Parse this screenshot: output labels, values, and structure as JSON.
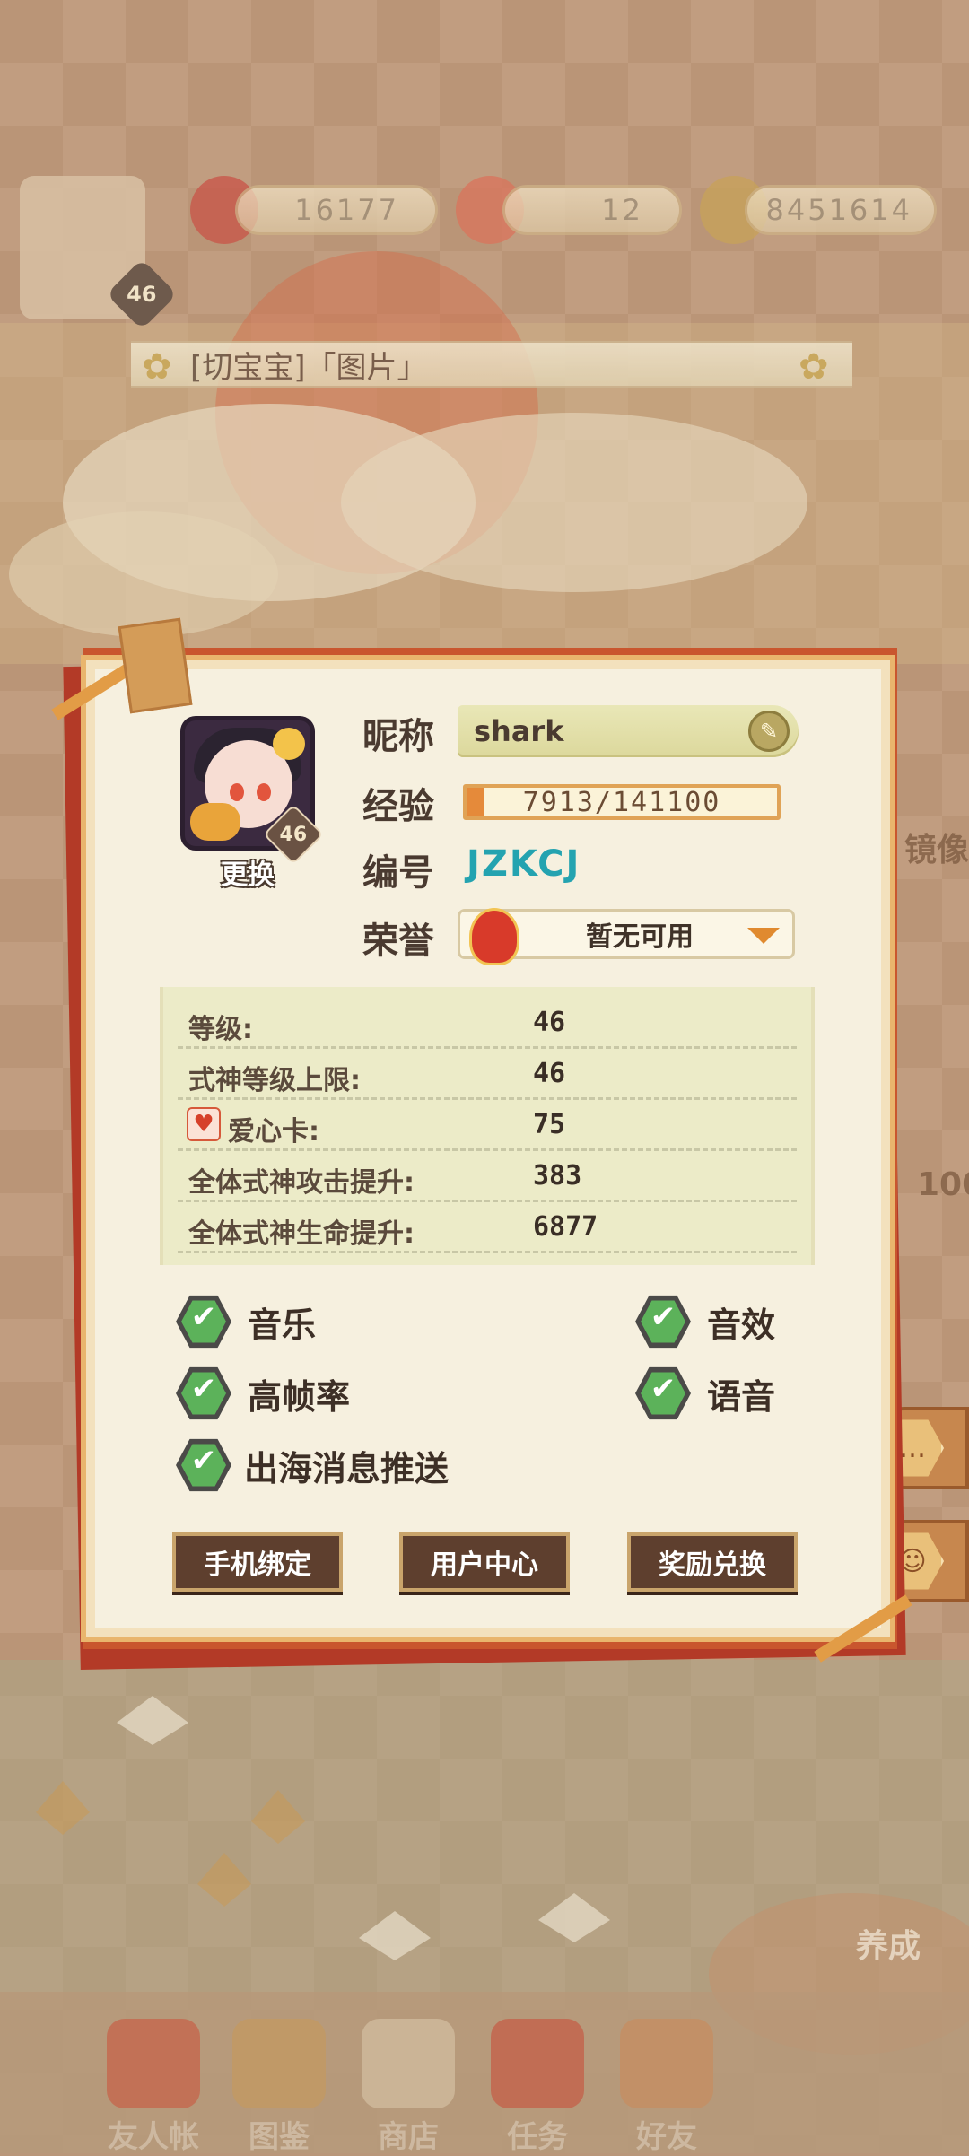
{
  "resources": {
    "jade": "16177",
    "stamina": "12",
    "coins": "8451614",
    "player_level": "46"
  },
  "notice": {
    "text": "[切宝宝]「图片」"
  },
  "background_labels": {
    "portrait_hint": "镜像",
    "training": "养成",
    "partial_number": "100"
  },
  "bottom_nav": [
    {
      "label": "友人帐"
    },
    {
      "label": "图鉴"
    },
    {
      "label": "商店"
    },
    {
      "label": "任务"
    },
    {
      "label": "好友"
    }
  ],
  "profile": {
    "avatar_level": "46",
    "change_label": "更换",
    "nickname_label": "昵称",
    "nickname": "shark",
    "exp_label": "经验",
    "exp_text": "7913/141100",
    "exp_fraction": 0.056,
    "id_label": "编号",
    "id_value": "JZKCJ",
    "honor_label": "荣誉",
    "honor_value": "暂无可用"
  },
  "stats": [
    {
      "label": "等级:",
      "value": "46"
    },
    {
      "label": "式神等级上限:",
      "value": "46"
    },
    {
      "label": "爱心卡:",
      "value": "75"
    },
    {
      "label": "全体式神攻击提升:",
      "value": "383"
    },
    {
      "label": "全体式神生命提升:",
      "value": "6877"
    }
  ],
  "settings": [
    {
      "label": "音乐",
      "checked": true
    },
    {
      "label": "音效",
      "checked": true
    },
    {
      "label": "高帧率",
      "checked": true
    },
    {
      "label": "语音",
      "checked": true
    },
    {
      "label": "出海消息推送",
      "checked": true
    }
  ],
  "buttons": {
    "phone_bind": "手机绑定",
    "user_center": "用户中心",
    "reward_redeem": "奖励兑换"
  },
  "colors": {
    "dialog_bg": "#f6f0df",
    "dialog_border": "#e9b56d",
    "id_text": "#24a3b0",
    "check_green": "#5cb25a",
    "button_bg": "#5e3f2e"
  }
}
